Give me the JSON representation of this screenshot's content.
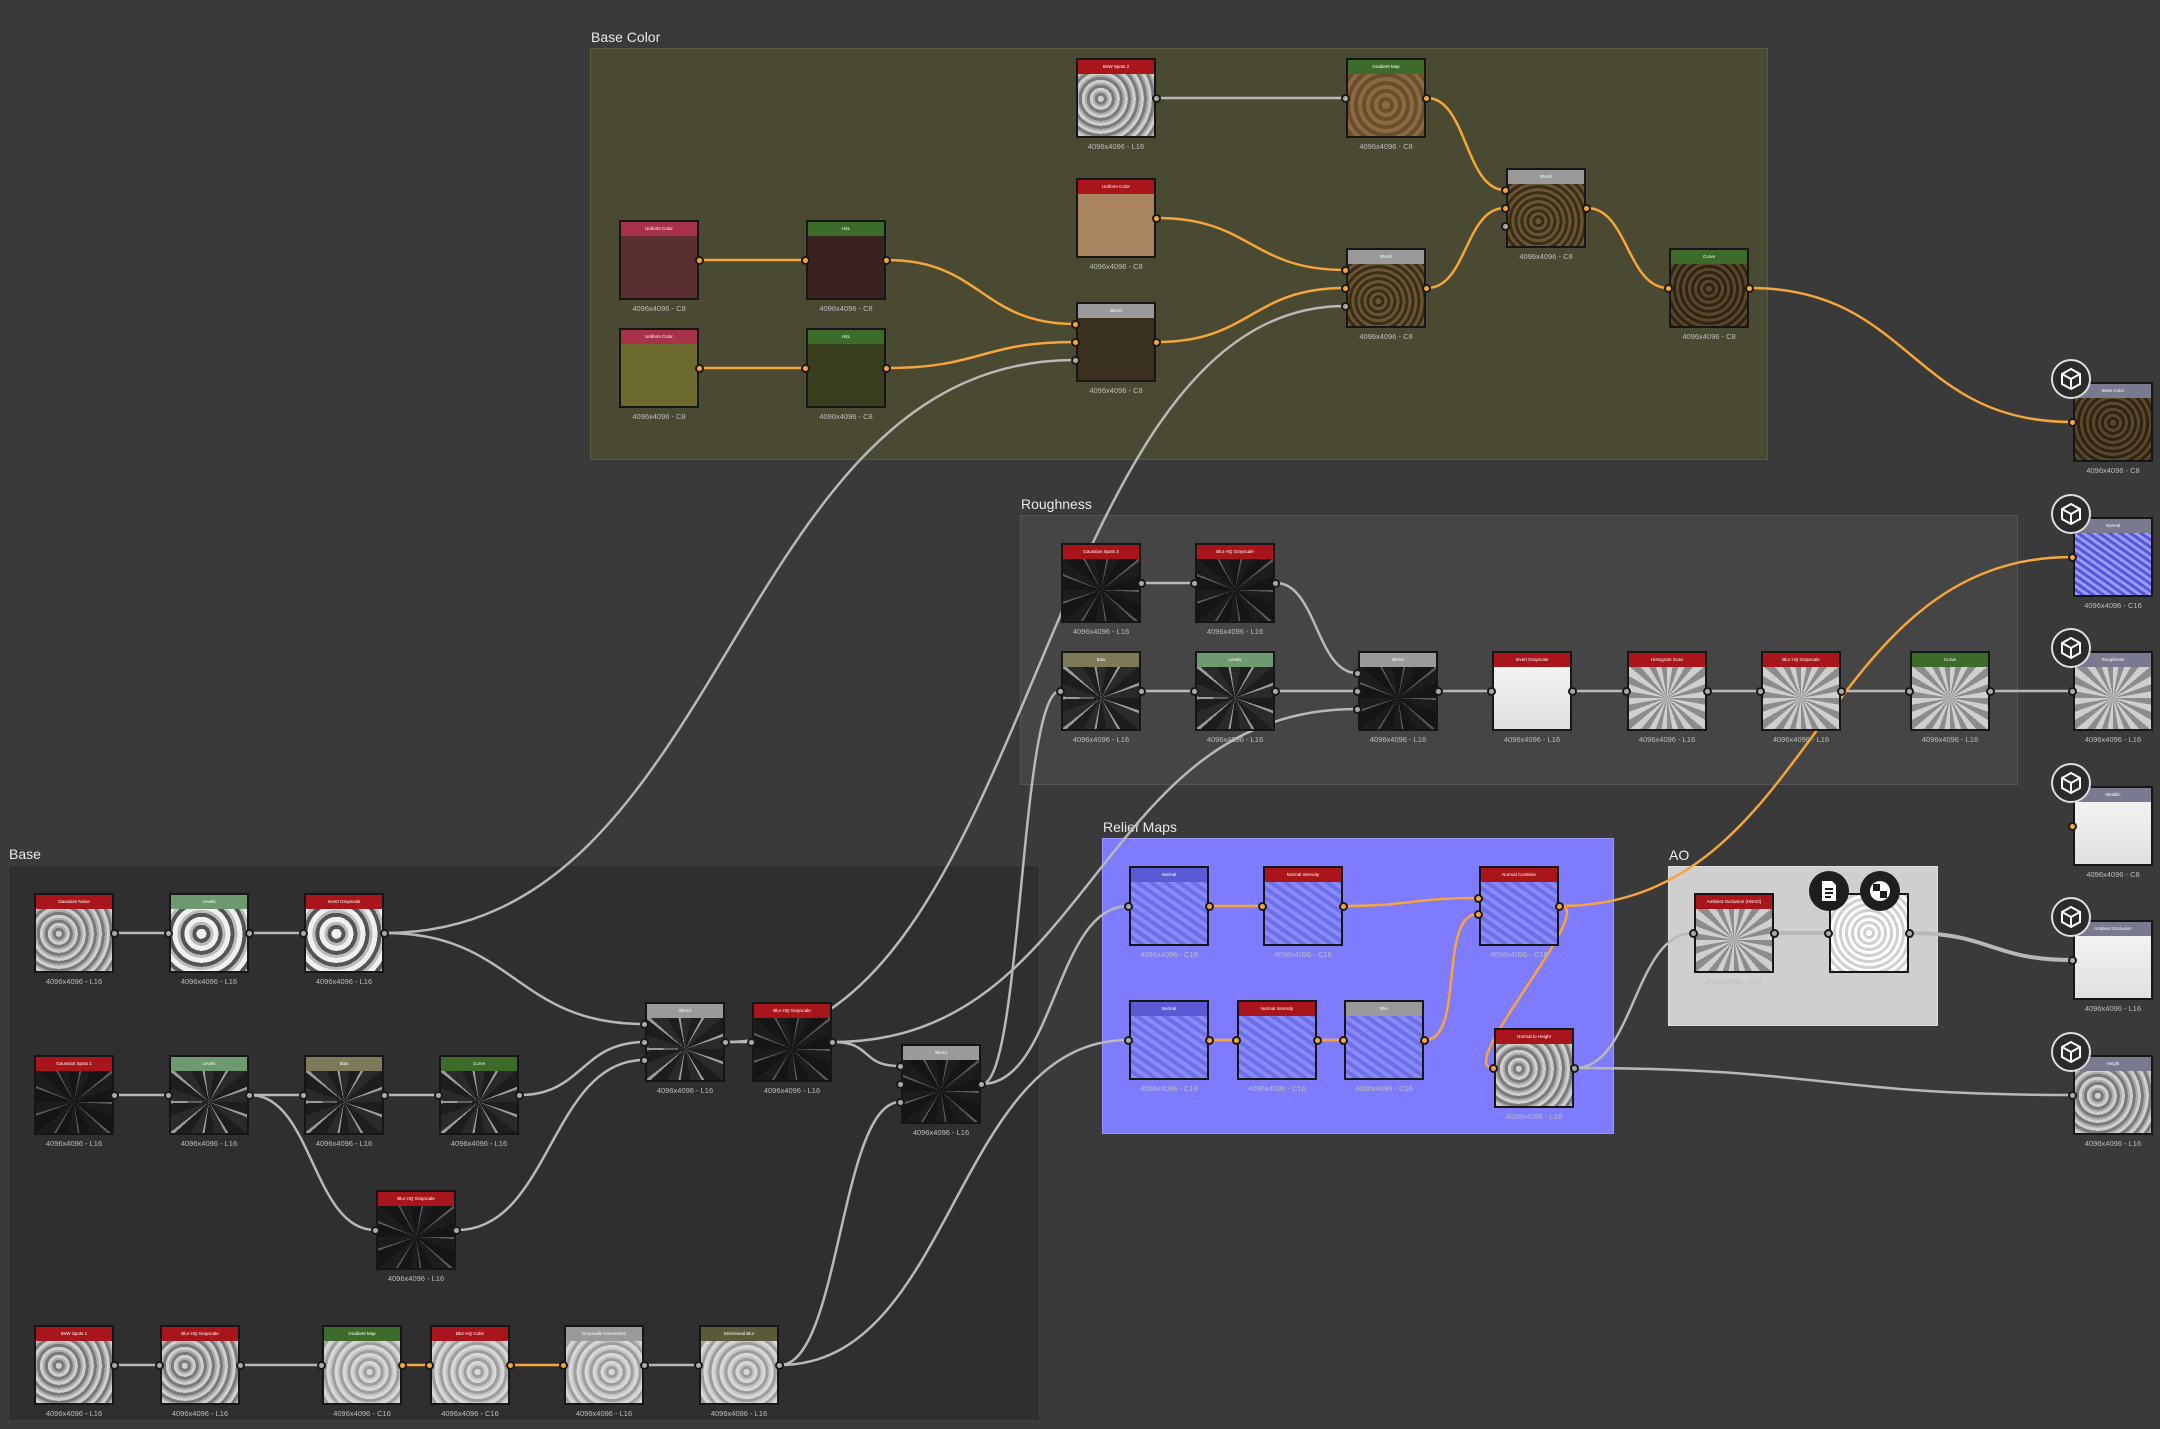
{
  "colors": {
    "header_red": "#a8161c",
    "header_green": "#3d6b2a",
    "header_lightgreen": "#6e9a72",
    "header_gray": "#9a9a9a",
    "header_khaki": "#7d7a5a",
    "header_pink": "#a8324a",
    "header_olive": "#5a5a38",
    "header_output": "#7a7a8f",
    "wire_gray": "#b8b8b8",
    "wire_orange": "#f5a53a"
  },
  "frames": [
    {
      "id": "frame-base-color",
      "title": "Base Color"
    },
    {
      "id": "frame-roughness",
      "title": "Roughness"
    },
    {
      "id": "frame-base",
      "title": "Base"
    },
    {
      "id": "frame-relief",
      "title": "Relief Maps"
    },
    {
      "id": "frame-ao",
      "title": "AO"
    }
  ],
  "nodes": [
    {
      "id": "bc_uc1",
      "title": "Uniform Color",
      "hdr": "pink",
      "thumb": "solid:#5a2f30",
      "caption": "4096x4096 - C8",
      "in": [],
      "out": [
        {
          "c": "o"
        }
      ]
    },
    {
      "id": "bc_hsl1",
      "title": "HSL",
      "hdr": "green",
      "thumb": "solid:#3a2222",
      "caption": "4096x4096 - C8",
      "in": [
        {
          "c": "o"
        }
      ],
      "out": [
        {
          "c": "o"
        }
      ]
    },
    {
      "id": "bc_uc2",
      "title": "Uniform Color",
      "hdr": "pink",
      "thumb": "solid:#6c6a2c",
      "caption": "4096x4096 - C8",
      "in": [],
      "out": [
        {
          "c": "o"
        }
      ]
    },
    {
      "id": "bc_hsl2",
      "title": "HSL",
      "hdr": "green",
      "thumb": "solid:#383e1e",
      "caption": "4096x4096 - C8",
      "in": [
        {
          "c": "o"
        }
      ],
      "out": [
        {
          "c": "o"
        }
      ]
    },
    {
      "id": "bc_blend1",
      "title": "Blend",
      "hdr": "gray",
      "thumb": "solid:#3a3020",
      "caption": "4096x4096 - C8",
      "in": [
        {
          "c": "o"
        },
        {
          "c": "o"
        },
        {
          "c": "g"
        }
      ],
      "out": [
        {
          "c": "o"
        }
      ]
    },
    {
      "id": "bc_uc3",
      "title": "Uniform Color",
      "hdr": "red",
      "thumb": "solid:#a88560",
      "caption": "4096x4096 - C8",
      "in": [],
      "out": [
        {
          "c": "o"
        }
      ]
    },
    {
      "id": "bc_bnz2",
      "title": "BnW Spots 2",
      "hdr": "red",
      "thumb": "cloud",
      "caption": "4096x4096 - L16",
      "in": [],
      "out": [
        {
          "c": "g"
        }
      ]
    },
    {
      "id": "bc_grad",
      "title": "Gradient Map",
      "hdr": "green",
      "thumb": "brown",
      "caption": "4096x4096 - C8",
      "in": [
        {
          "c": "g"
        }
      ],
      "out": [
        {
          "c": "o"
        }
      ]
    },
    {
      "id": "bc_blend2",
      "title": "Blend",
      "hdr": "gray",
      "thumb": "dirt",
      "caption": "4096x4096 - C8",
      "in": [
        {
          "c": "o"
        },
        {
          "c": "o"
        },
        {
          "c": "g"
        }
      ],
      "out": [
        {
          "c": "o"
        }
      ]
    },
    {
      "id": "bc_blend3",
      "title": "Blend",
      "hdr": "gray",
      "thumb": "dirt",
      "caption": "4096x4096 - C8",
      "in": [
        {
          "c": "o"
        },
        {
          "c": "o"
        },
        {
          "c": "g"
        }
      ],
      "out": [
        {
          "c": "o"
        }
      ]
    },
    {
      "id": "bc_curve",
      "title": "Curve",
      "hdr": "green",
      "thumb": "dirtdark",
      "caption": "4096x4096 - C8",
      "in": [
        {
          "c": "o"
        }
      ],
      "out": [
        {
          "c": "o"
        }
      ]
    },
    {
      "id": "r_gs3",
      "title": "Gaussian Spots 3",
      "hdr": "red",
      "thumb": "speckdark",
      "caption": "4096x4096 - L16",
      "in": [],
      "out": [
        {
          "c": "g"
        }
      ]
    },
    {
      "id": "r_blurhq",
      "title": "Blur HQ Grayscale",
      "hdr": "red",
      "thumb": "speckdark",
      "caption": "4096x4096 - L16",
      "in": [
        {
          "c": "g"
        }
      ],
      "out": [
        {
          "c": "g"
        }
      ]
    },
    {
      "id": "r_bias",
      "title": "Bias",
      "hdr": "khaki",
      "thumb": "speckle",
      "caption": "4096x4096 - L16",
      "in": [
        {
          "c": "g"
        }
      ],
      "out": [
        {
          "c": "g"
        }
      ]
    },
    {
      "id": "r_levels",
      "title": "Levels",
      "hdr": "lightgreen",
      "thumb": "speckle",
      "caption": "4096x4096 - L16",
      "in": [
        {
          "c": "g"
        }
      ],
      "out": [
        {
          "c": "g"
        }
      ]
    },
    {
      "id": "r_blend",
      "title": "Blend",
      "hdr": "gray",
      "thumb": "speckdark",
      "caption": "4096x4096 - L16",
      "in": [
        {
          "c": "g"
        },
        {
          "c": "g"
        },
        {
          "c": "g"
        }
      ],
      "out": [
        {
          "c": "g"
        }
      ]
    },
    {
      "id": "r_invert",
      "title": "Invert Grayscale",
      "hdr": "red",
      "thumb": "white",
      "caption": "4096x4096 - L16",
      "in": [
        {
          "c": "g"
        }
      ],
      "out": [
        {
          "c": "g"
        }
      ]
    },
    {
      "id": "r_hscan",
      "title": "Histogram Scan",
      "hdr": "red",
      "thumb": "noise",
      "caption": "4096x4096 - L16",
      "in": [
        {
          "c": "g"
        }
      ],
      "out": [
        {
          "c": "g"
        }
      ]
    },
    {
      "id": "r_blurhq2",
      "title": "Blur HQ Grayscale",
      "hdr": "red",
      "thumb": "noise",
      "caption": "4096x4096 - L16",
      "in": [
        {
          "c": "g"
        }
      ],
      "out": [
        {
          "c": "g"
        }
      ]
    },
    {
      "id": "r_curve",
      "title": "Curve",
      "hdr": "green",
      "thumb": "noise",
      "caption": "4096x4096 - L16",
      "in": [
        {
          "c": "g"
        }
      ],
      "out": [
        {
          "c": "g"
        }
      ]
    },
    {
      "id": "b_gnoise",
      "title": "Gaussian Noise",
      "hdr": "red",
      "thumb": "cloud",
      "caption": "4096x4096 - L16",
      "in": [],
      "out": [
        {
          "c": "g"
        }
      ]
    },
    {
      "id": "b_levels1",
      "title": "Levels",
      "hdr": "lightgreen",
      "thumb": "blobs",
      "caption": "4096x4096 - L16",
      "in": [
        {
          "c": "g"
        }
      ],
      "out": [
        {
          "c": "g"
        }
      ]
    },
    {
      "id": "b_invert",
      "title": "Invert Grayscale",
      "hdr": "red",
      "thumb": "blobs",
      "caption": "4096x4096 - L16",
      "in": [
        {
          "c": "g"
        }
      ],
      "out": [
        {
          "c": "g"
        }
      ]
    },
    {
      "id": "b_gs1",
      "title": "Gaussian Spots 1",
      "hdr": "red",
      "thumb": "speckdark",
      "caption": "4096x4096 - L16",
      "in": [],
      "out": [
        {
          "c": "g"
        }
      ]
    },
    {
      "id": "b_levels2",
      "title": "Levels",
      "hdr": "lightgreen",
      "thumb": "speckle",
      "caption": "4096x4096 - L16",
      "in": [
        {
          "c": "g"
        }
      ],
      "out": [
        {
          "c": "g"
        }
      ]
    },
    {
      "id": "b_bias",
      "title": "Bias",
      "hdr": "khaki",
      "thumb": "speckle",
      "caption": "4096x4096 - L16",
      "in": [
        {
          "c": "g"
        }
      ],
      "out": [
        {
          "c": "g"
        }
      ]
    },
    {
      "id": "b_curve",
      "title": "Curve",
      "hdr": "green",
      "thumb": "speckle",
      "caption": "4096x4096 - L16",
      "in": [
        {
          "c": "g"
        }
      ],
      "out": [
        {
          "c": "g"
        }
      ]
    },
    {
      "id": "b_blurhq",
      "title": "Blur HQ Grayscale",
      "hdr": "red",
      "thumb": "speckdark",
      "caption": "4096x4096 - L16",
      "in": [
        {
          "c": "g"
        }
      ],
      "out": [
        {
          "c": "g"
        }
      ]
    },
    {
      "id": "b_blend1",
      "title": "Blend",
      "hdr": "gray",
      "thumb": "speckle",
      "caption": "4096x4096 - L16",
      "in": [
        {
          "c": "g"
        },
        {
          "c": "g"
        },
        {
          "c": "g"
        }
      ],
      "out": [
        {
          "c": "g"
        }
      ]
    },
    {
      "id": "b_blurhq2",
      "title": "Blur HQ Grayscale",
      "hdr": "red",
      "thumb": "speckdark",
      "caption": "4096x4096 - L16",
      "in": [
        {
          "c": "g"
        }
      ],
      "out": [
        {
          "c": "g"
        }
      ]
    },
    {
      "id": "b_blend2",
      "title": "Blend",
      "hdr": "gray",
      "thumb": "speckdark",
      "caption": "4096x4096 - L16",
      "in": [
        {
          "c": "g"
        },
        {
          "c": "g"
        },
        {
          "c": "g"
        }
      ],
      "out": [
        {
          "c": "g"
        }
      ]
    },
    {
      "id": "b_bnw1",
      "title": "BnW Spots 1",
      "hdr": "red",
      "thumb": "cloud",
      "caption": "4096x4096 - L16",
      "in": [],
      "out": [
        {
          "c": "g"
        }
      ]
    },
    {
      "id": "b_blurhq3",
      "title": "Blur HQ Grayscale",
      "hdr": "red",
      "thumb": "cloud",
      "caption": "4096x4096 - L16",
      "in": [
        {
          "c": "g"
        }
      ],
      "out": [
        {
          "c": "g"
        }
      ]
    },
    {
      "id": "b_gradmap",
      "title": "Gradient Map",
      "hdr": "green",
      "thumb": "cloudlight",
      "caption": "4096x4096 - C16",
      "in": [
        {
          "c": "g"
        }
      ],
      "out": [
        {
          "c": "o"
        }
      ]
    },
    {
      "id": "b_blurhqc",
      "title": "Blur HQ Color",
      "hdr": "red",
      "thumb": "cloudlight",
      "caption": "4096x4096 - C16",
      "in": [
        {
          "c": "o"
        }
      ],
      "out": [
        {
          "c": "o"
        }
      ]
    },
    {
      "id": "b_gconv",
      "title": "Grayscale Conversion",
      "hdr": "gray",
      "thumb": "cloudlight",
      "caption": "4096x4096 - L16",
      "in": [
        {
          "c": "o"
        }
      ],
      "out": [
        {
          "c": "g"
        }
      ]
    },
    {
      "id": "b_dblur",
      "title": "Directional Blur",
      "hdr": "olive",
      "thumb": "cloudlight",
      "caption": "4096x4096 - L16",
      "in": [
        {
          "c": "g"
        }
      ],
      "out": [
        {
          "c": "g"
        }
      ]
    },
    {
      "id": "rm_normal1",
      "title": "Normal",
      "hdr": "blue",
      "thumb": "normal",
      "caption": "4096x4096 - C16",
      "in": [
        {
          "c": "g"
        }
      ],
      "out": [
        {
          "c": "o"
        }
      ]
    },
    {
      "id": "rm_nint1",
      "title": "Normal Intensity",
      "hdr": "red",
      "thumb": "normal",
      "caption": "4096x4096 - C16",
      "in": [
        {
          "c": "o"
        }
      ],
      "out": [
        {
          "c": "o"
        }
      ]
    },
    {
      "id": "rm_ncomb",
      "title": "Normal Combine",
      "hdr": "red",
      "thumb": "normal",
      "caption": "4096x4096 - C16",
      "in": [
        {
          "c": "o"
        },
        {
          "c": "o"
        }
      ],
      "out": [
        {
          "c": "o"
        }
      ]
    },
    {
      "id": "rm_normal2",
      "title": "Normal",
      "hdr": "blue",
      "thumb": "normal",
      "caption": "4096x4096 - C16",
      "in": [
        {
          "c": "g"
        }
      ],
      "out": [
        {
          "c": "o"
        }
      ]
    },
    {
      "id": "rm_nint2",
      "title": "Normal Intensity",
      "hdr": "red",
      "thumb": "normal",
      "caption": "4096x4096 - C16",
      "in": [
        {
          "c": "o"
        }
      ],
      "out": [
        {
          "c": "o"
        }
      ]
    },
    {
      "id": "rm_blur",
      "title": "Blur",
      "hdr": "gray",
      "thumb": "normal",
      "caption": "4096x4096 - C16",
      "in": [
        {
          "c": "o"
        }
      ],
      "out": [
        {
          "c": "o"
        }
      ]
    },
    {
      "id": "rm_n2h",
      "title": "Normal to Height",
      "hdr": "red",
      "thumb": "cloud",
      "caption": "4096x4096 - L16",
      "in": [
        {
          "c": "o"
        }
      ],
      "out": [
        {
          "c": "g"
        }
      ]
    },
    {
      "id": "ao_node",
      "title": "Ambient Occlusion (HBAO)",
      "hdr": "red",
      "thumb": "noise",
      "caption": "4096x4096 - L16",
      "in": [
        {
          "c": "g"
        }
      ],
      "out": [
        {
          "c": "g"
        }
      ]
    },
    {
      "id": "ao_out",
      "title": "",
      "hdr": "none",
      "thumb": "ao",
      "caption": "",
      "in": [
        {
          "c": "g"
        }
      ],
      "out": [
        {
          "c": "g"
        }
      ]
    },
    {
      "id": "out_basecolor",
      "title": "Base Color",
      "hdr": "output",
      "thumb": "dirtdark",
      "caption": "4096x4096 - C8",
      "in": [
        {
          "c": "o"
        }
      ],
      "out": []
    },
    {
      "id": "out_normal",
      "title": "Normal",
      "hdr": "output",
      "thumb": "normalout",
      "caption": "4096x4096 - C16",
      "in": [
        {
          "c": "o"
        }
      ],
      "out": []
    },
    {
      "id": "out_roughness",
      "title": "Roughness",
      "hdr": "output",
      "thumb": "noise",
      "caption": "4096x4096 - L16",
      "in": [
        {
          "c": "g"
        }
      ],
      "out": []
    },
    {
      "id": "out_metallic",
      "title": "Metallic",
      "hdr": "output",
      "thumb": "white",
      "caption": "4096x4096 - C8",
      "in": [
        {
          "c": "o"
        }
      ],
      "out": []
    },
    {
      "id": "out_ao",
      "title": "Ambient Occlusion",
      "hdr": "output",
      "thumb": "white",
      "caption": "4096x4096 - L16",
      "in": [
        {
          "c": "g"
        }
      ],
      "out": []
    },
    {
      "id": "out_height",
      "title": "Height",
      "hdr": "output",
      "thumb": "cloud",
      "caption": "4096x4096 - L16",
      "in": [
        {
          "c": "g"
        }
      ],
      "out": []
    }
  ],
  "output_icons": [
    "cube-icon",
    "cube-icon",
    "cube-icon",
    "cube-icon",
    "cube-icon",
    "cube-icon"
  ],
  "ao_icons": [
    "document-icon",
    "checker-icon"
  ]
}
